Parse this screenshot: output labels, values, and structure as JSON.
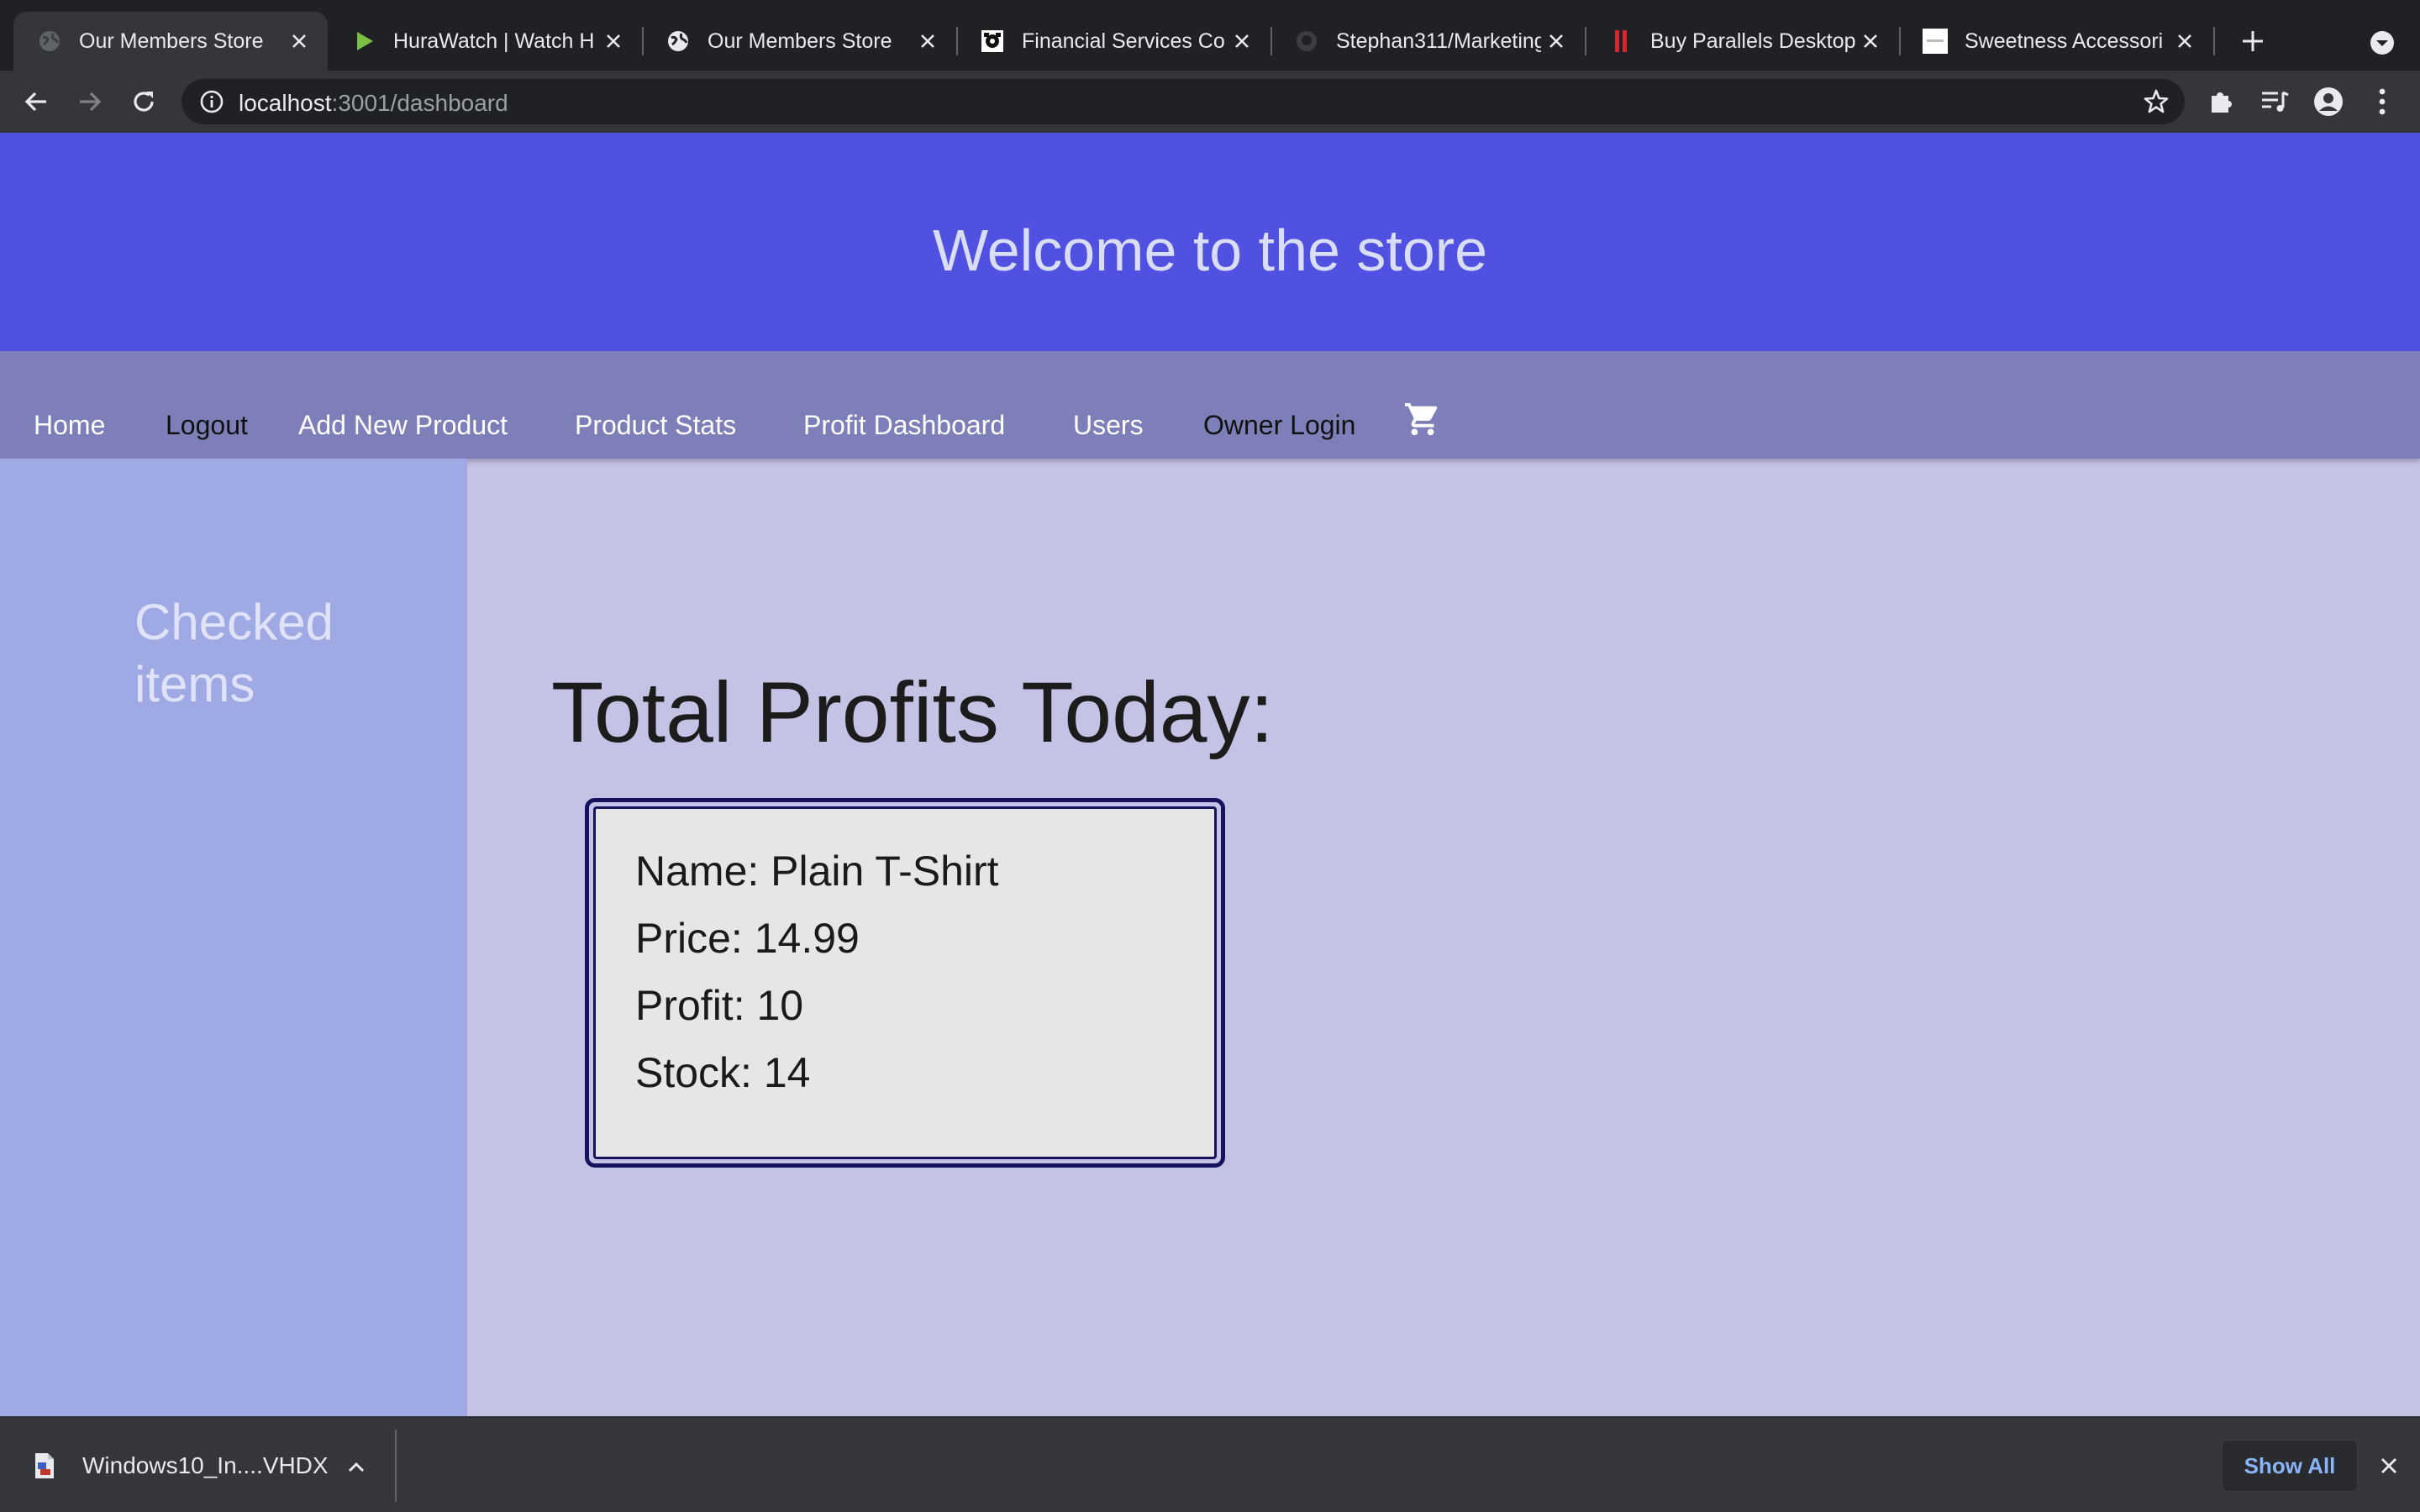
{
  "browser": {
    "tabs": [
      {
        "title": "Our Members Store",
        "active": true,
        "favicon": "globe-icon"
      },
      {
        "title": "HuraWatch | Watch H",
        "active": false,
        "favicon": "play-icon"
      },
      {
        "title": "Our Members Store",
        "active": false,
        "favicon": "globe-icon"
      },
      {
        "title": "Financial Services Co",
        "active": false,
        "favicon": "bank-icon"
      },
      {
        "title": "Stephan311/Marketing",
        "active": false,
        "favicon": "github-icon"
      },
      {
        "title": "Buy Parallels Desktop",
        "active": false,
        "favicon": "parallels-icon"
      },
      {
        "title": "Sweetness Accessori",
        "active": false,
        "favicon": "sweetness-icon"
      }
    ],
    "url_host": "localhost",
    "url_path": ":3001/dashboard"
  },
  "page": {
    "banner_title": "Welcome to the store",
    "nav": {
      "home": "Home",
      "logout": "Logout",
      "add_product": "Add New Product",
      "product_stats": "Product Stats",
      "profit_dashboard": "Profit Dashboard",
      "users": "Users",
      "owner_login": "Owner Login"
    },
    "sidebar_title": "Checked items",
    "heading": "Total Profits Today:",
    "product": {
      "name": "Name: Plain T-Shirt",
      "price": "Price: 14.99",
      "profit": "Profit: 10",
      "stock": "Stock: 14"
    }
  },
  "downloads": {
    "file_name": "Windows10_In....VHDX",
    "show_all": "Show All"
  },
  "colors": {
    "banner": "#5051e0",
    "nav": "#7e7fb9",
    "sidebar": "#9fa9e4",
    "content": "#c4c2e5",
    "card_border": "#17125e",
    "card_bg": "#e6e6e6"
  }
}
